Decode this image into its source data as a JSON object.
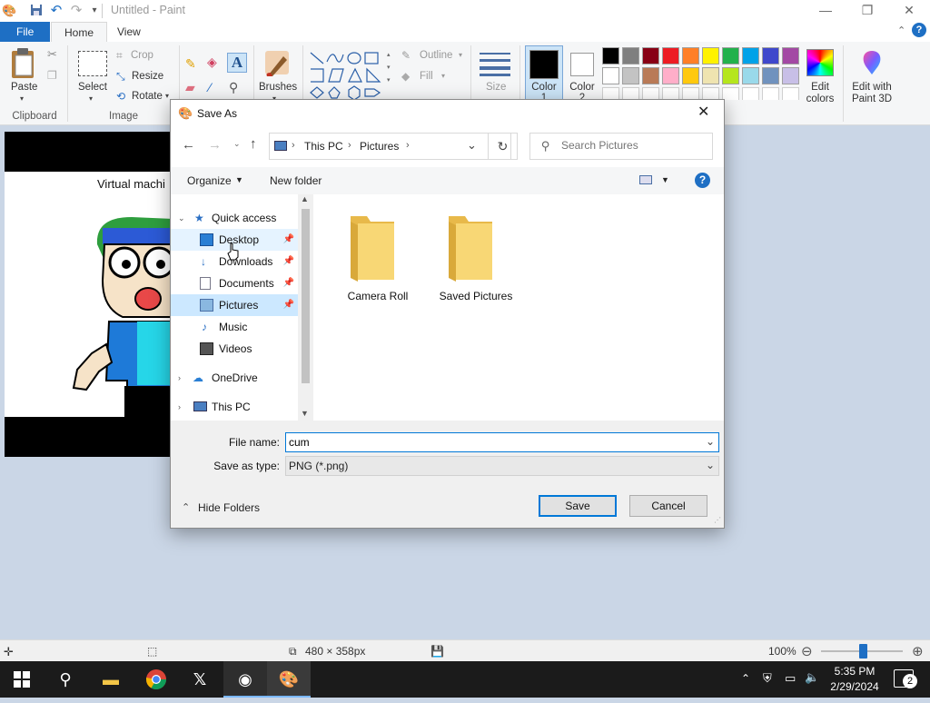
{
  "window": {
    "title": "Untitled - Paint"
  },
  "menu": {
    "file": "File",
    "home": "Home",
    "view": "View"
  },
  "ribbon": {
    "clipboard": {
      "paste": "Paste",
      "label": "Clipboard"
    },
    "image": {
      "select": "Select",
      "crop": "Crop",
      "resize": "Resize",
      "rotate": "Rotate",
      "label": "Image"
    },
    "brushes": "Brushes",
    "shapes": {
      "outline": "Outline",
      "fill": "Fill"
    },
    "size": "Size",
    "color1": "Color 1",
    "color2": "Color 2",
    "edit_colors": "Edit colors",
    "edit_paint3d": "Edit with Paint 3D",
    "palette_row1": [
      "#000000",
      "#7f7f7f",
      "#880015",
      "#ed1c24",
      "#ff7f27",
      "#fff200",
      "#22b14c",
      "#00a2e8",
      "#3f48cc",
      "#a349a4"
    ],
    "palette_row2": [
      "#ffffff",
      "#c3c3c3",
      "#b97a57",
      "#ffaec9",
      "#ffc90e",
      "#efe4b0",
      "#b5e61d",
      "#99d9ea",
      "#7092be",
      "#c8bfe7"
    ]
  },
  "canvas": {
    "text": "Virtual machi"
  },
  "dialog": {
    "title": "Save As",
    "breadcrumb": [
      "This PC",
      "Pictures"
    ],
    "search_placeholder": "Search Pictures",
    "organize": "Organize",
    "new_folder": "New folder",
    "nav": {
      "quick_access": "Quick access",
      "desktop": "Desktop",
      "downloads": "Downloads",
      "documents": "Documents",
      "pictures": "Pictures",
      "music": "Music",
      "videos": "Videos",
      "onedrive": "OneDrive",
      "this_pc": "This PC"
    },
    "folders": [
      "Camera Roll",
      "Saved Pictures"
    ],
    "file_name_label": "File name:",
    "file_name_value": "cum",
    "save_type_label": "Save as type:",
    "save_type_value": "PNG (*.png)",
    "hide_folders": "Hide Folders",
    "save": "Save",
    "cancel": "Cancel"
  },
  "status": {
    "dimensions": "480 × 358px",
    "zoom": "100%"
  },
  "taskbar": {
    "time": "5:35 PM",
    "date": "2/29/2024",
    "notifications": "2"
  }
}
